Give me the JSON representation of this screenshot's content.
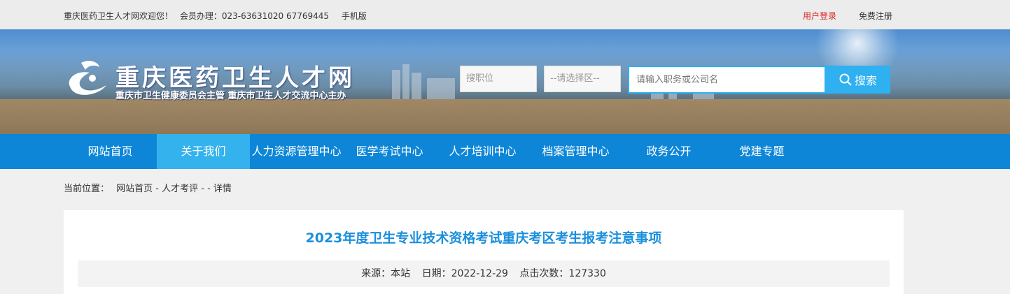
{
  "topbar": {
    "welcome": "重庆医药卫生人才网欢迎您！",
    "member_label": "会员办理：023-63631020 67769445",
    "mobile": "手机版",
    "login": "用户登录",
    "register": "免费注册"
  },
  "header": {
    "site_title": "重庆医药卫生人才网",
    "subtitle": "重庆市卫生健康委员会主管 重庆市卫生人才交流中心主办",
    "search": {
      "position_select": "搜职位",
      "area_select": "--请选择区--",
      "keyword_placeholder": "请输入职务或公司名",
      "button_label": "搜索"
    }
  },
  "nav": {
    "items": [
      {
        "label": "网站首页"
      },
      {
        "label": "关于我们"
      },
      {
        "label": "人力资源管理中心"
      },
      {
        "label": "医学考试中心"
      },
      {
        "label": "人才培训中心"
      },
      {
        "label": "档案管理中心"
      },
      {
        "label": "政务公开"
      },
      {
        "label": "党建专题"
      }
    ],
    "active_index": 1
  },
  "breadcrumb": {
    "label": "当前位置：",
    "path": "网站首页 - 人才考评 - - 详情"
  },
  "article": {
    "title": "2023年度卫生专业技术资格考试重庆考区考生报考注意事项",
    "source": "来源：本站",
    "date": "日期：2022-12-29",
    "clicks": "点击次数：127330"
  },
  "colors": {
    "nav_bg": "#0d86d8",
    "nav_active": "#34b2ee",
    "search_accent": "#2fb0f0",
    "title_blue": "#1a8fdd",
    "login_red": "#dd2222"
  }
}
